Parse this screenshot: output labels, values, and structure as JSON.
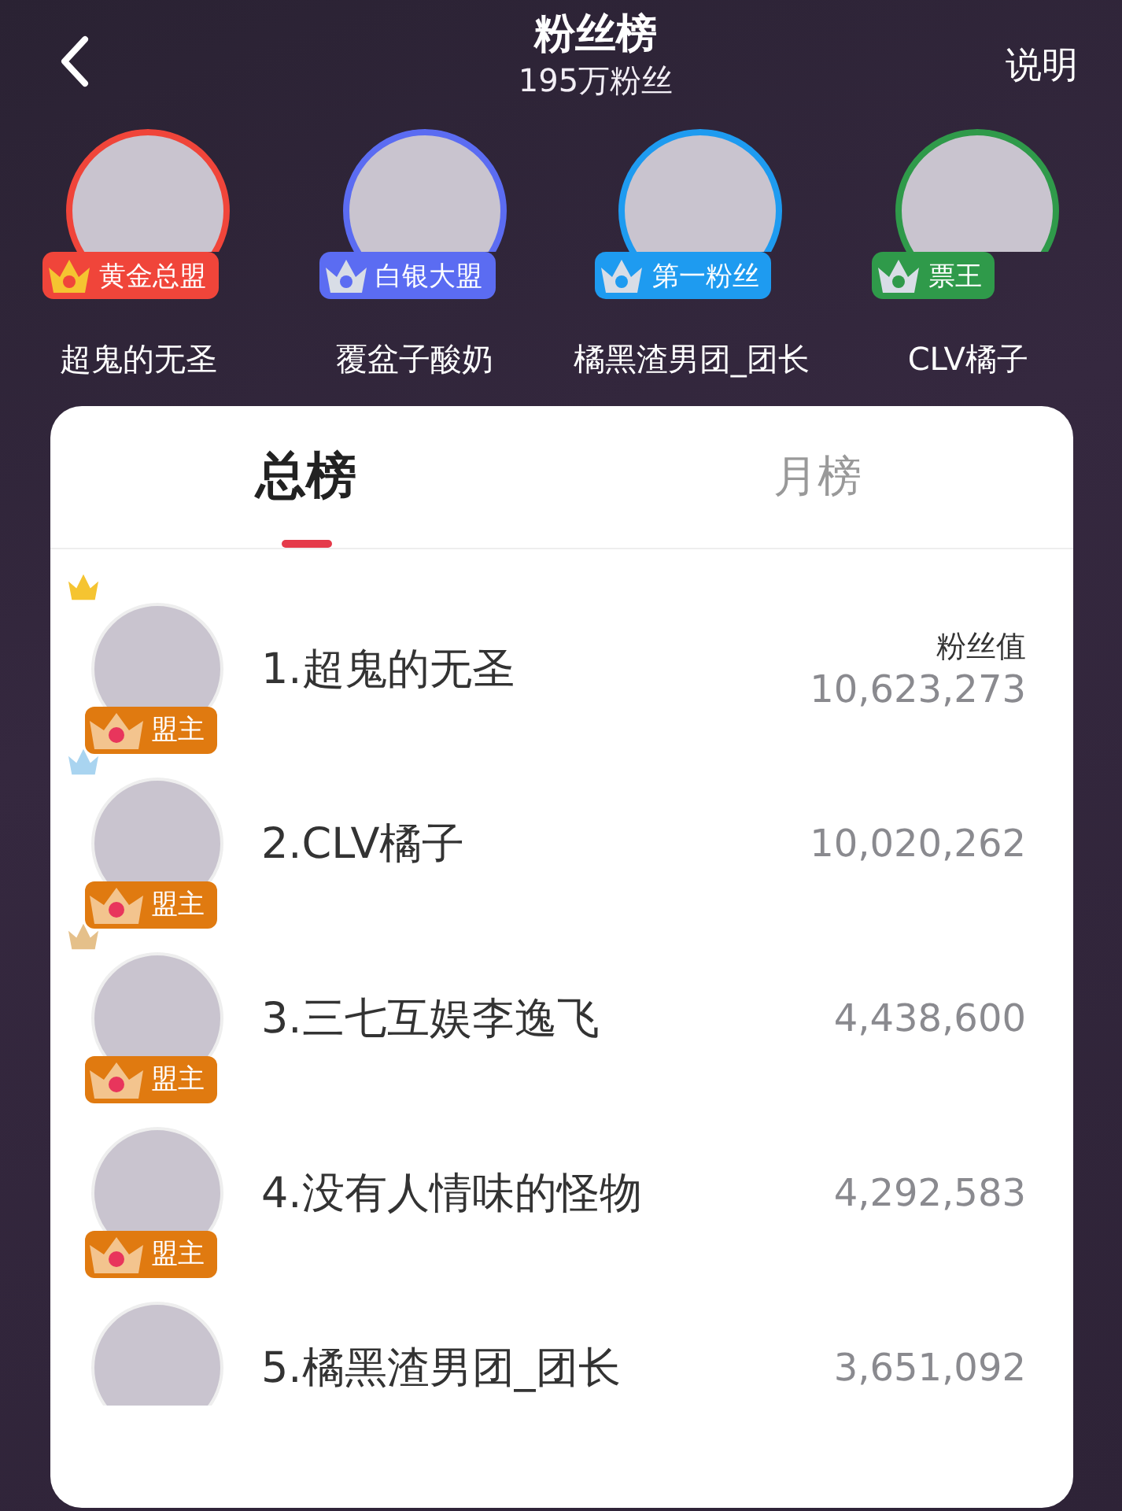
{
  "header": {
    "title": "粉丝榜",
    "subtitle": "195万粉丝",
    "help": "说明"
  },
  "top_fans": [
    {
      "name": "超鬼的无圣",
      "badge": "黄金总盟",
      "color": "#f0453a"
    },
    {
      "name": "覆盆子酸奶",
      "badge": "白银大盟",
      "color": "#5b6cf2"
    },
    {
      "name": "橘黑渣男团_团长",
      "badge": "第一粉丝",
      "color": "#1e9bf0"
    },
    {
      "name": "CLV橘子",
      "badge": "票王",
      "color": "#2f9a4a"
    }
  ],
  "tabs": [
    {
      "label": "总榜",
      "selected": true
    },
    {
      "label": "月榜",
      "selected": false
    }
  ],
  "value_heading": "粉丝值",
  "ranking": [
    {
      "name": "1.超鬼的无圣",
      "value": "10,623,273",
      "badge": "盟主",
      "color": "#f5c431"
    },
    {
      "name": "2.CLV橘子",
      "value": "10,020,262",
      "badge": "盟主",
      "color": "#a9d4f0"
    },
    {
      "name": "3.三七互娱李逸飞",
      "value": "4,438,600",
      "badge": "盟主",
      "color": "#e5c08a"
    },
    {
      "name": "4.没有人情味的怪物",
      "value": "4,292,583",
      "badge": "盟主"
    },
    {
      "name": "5.橘黑渣男团_团长",
      "value": "3,651,092"
    }
  ]
}
